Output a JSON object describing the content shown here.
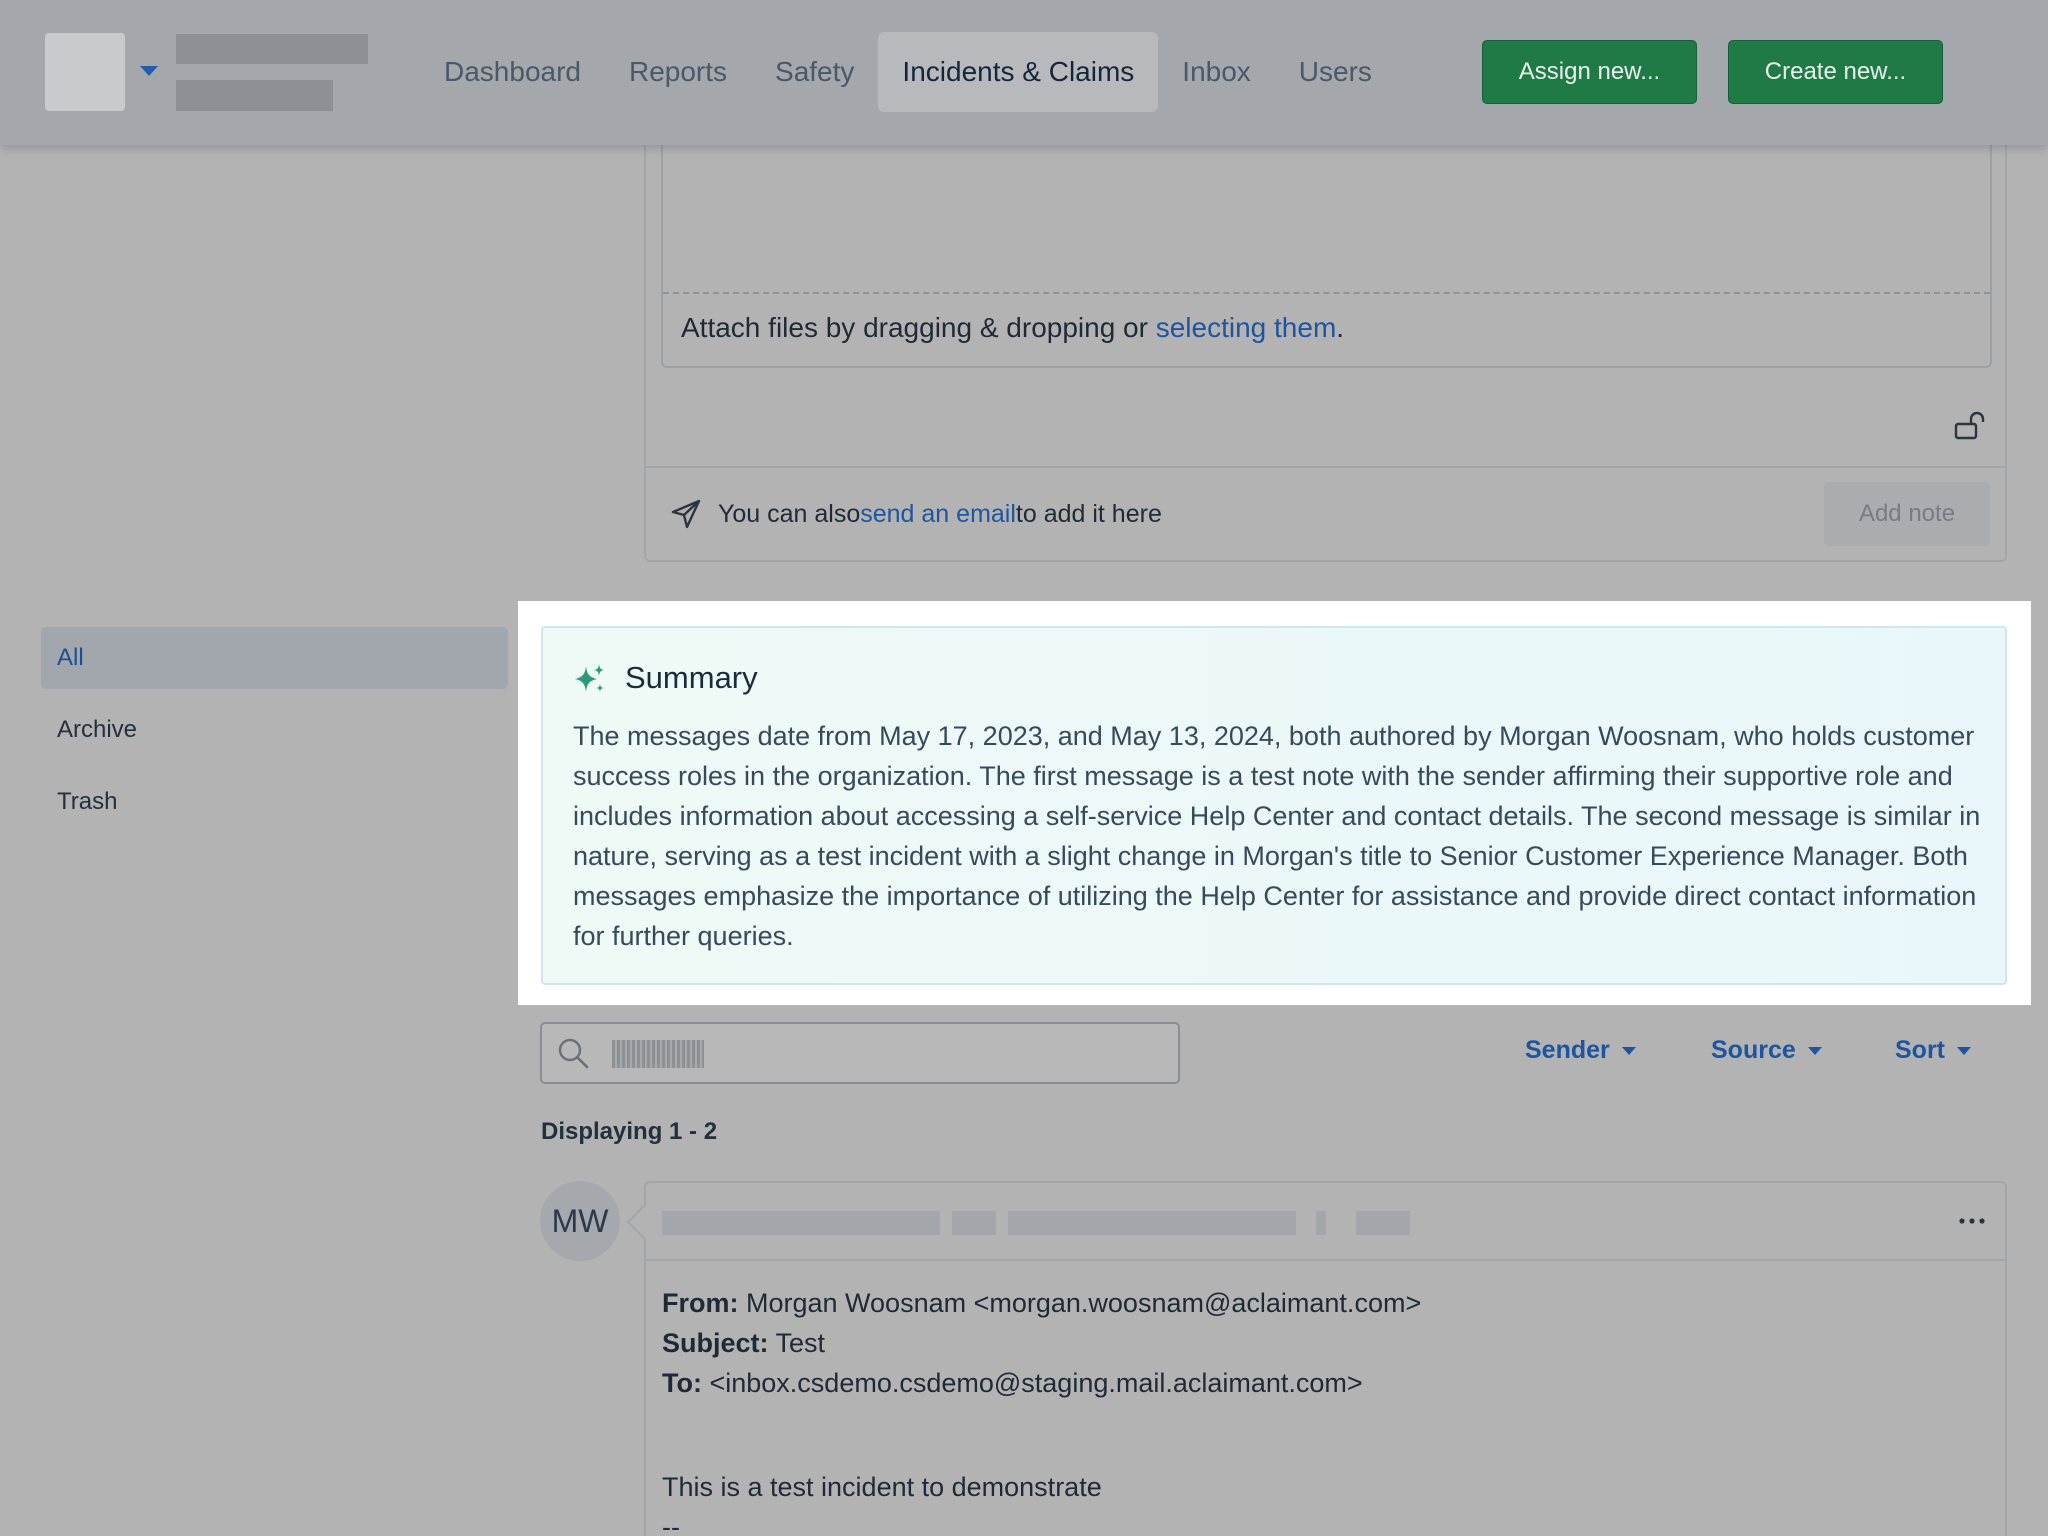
{
  "nav": {
    "items": [
      {
        "label": "Dashboard"
      },
      {
        "label": "Reports"
      },
      {
        "label": "Safety"
      },
      {
        "label": "Incidents & Claims",
        "active": true
      },
      {
        "label": "Inbox"
      },
      {
        "label": "Users"
      }
    ],
    "assign_label": "Assign new...",
    "create_label": "Create new..."
  },
  "editor": {
    "attach_prefix": "Attach files by dragging & dropping or ",
    "attach_link": "selecting them",
    "attach_suffix": ".",
    "send_prefix": "You can also ",
    "send_link": "send an email",
    "send_suffix": " to add it here",
    "add_note_label": "Add note"
  },
  "sidebar": {
    "items": [
      {
        "label": "All",
        "active": true
      },
      {
        "label": "Archive"
      },
      {
        "label": "Trash"
      }
    ]
  },
  "summary": {
    "title": "Summary",
    "text": "The messages date from May 17, 2023, and May 13, 2024, both authored by Morgan Woosnam, who holds customer success roles in the organization. The first message is a test note with the sender affirming their supportive role and includes information about accessing a self-service Help Center and contact details. The second message is similar in nature, serving as a test incident with a slight change in Morgan's title to Senior Customer Experience Manager. Both messages emphasize the importance of utilizing the Help Center for assistance and provide direct contact information for further queries."
  },
  "filters": {
    "sender": "Sender",
    "source": "Source",
    "sort": "Sort"
  },
  "list": {
    "displaying": "Displaying 1 - 2"
  },
  "message": {
    "avatar_initials": "MW",
    "from_label": "From:",
    "from_value": " Morgan Woosnam <morgan.woosnam@aclaimant.com>",
    "subject_label": "Subject:",
    "subject_value": " Test",
    "to_label": "To:",
    "to_value": " <inbox.csdemo.csdemo@staging.mail.aclaimant.com>",
    "body_line1": "This is a test incident to demonstrate",
    "body_line2": "--"
  },
  "colors": {
    "accent_green": "#1f7a46",
    "link_blue": "#1d55a0",
    "summary_bg": "#eefaf6"
  }
}
